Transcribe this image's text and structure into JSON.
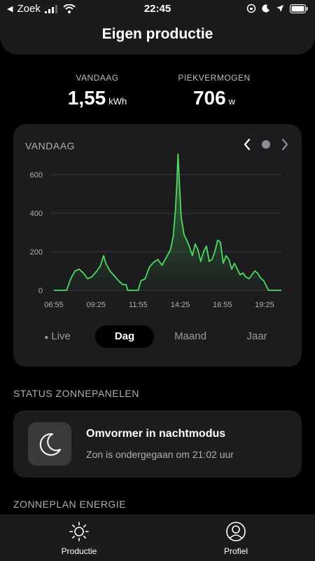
{
  "statusbar": {
    "back_label": "Zoek",
    "time": "22:45"
  },
  "header": {
    "title": "Eigen productie"
  },
  "stats": [
    {
      "label": "VANDAAG",
      "value": "1,55",
      "unit": "kWh"
    },
    {
      "label": "PIEKVERMOGEN",
      "value": "706",
      "unit": "w"
    }
  ],
  "chart_card": {
    "title": "VANDAAG",
    "tabs": [
      {
        "label": "Live",
        "active": false
      },
      {
        "label": "Dag",
        "active": true
      },
      {
        "label": "Maand",
        "active": false
      },
      {
        "label": "Jaar",
        "active": false
      }
    ]
  },
  "chart_data": {
    "type": "area",
    "title": "",
    "xlabel": "",
    "ylabel": "",
    "ylim": [
      0,
      600
    ],
    "yticks": [
      0,
      200,
      400,
      600
    ],
    "x_tick_labels": [
      "06:55",
      "09:25",
      "11:55",
      "14:25",
      "16:55",
      "19:25"
    ],
    "x_tick_minutes": [
      415,
      565,
      715,
      865,
      1015,
      1165
    ],
    "xlim_minutes": [
      415,
      1225
    ],
    "line_color": "#4cd964",
    "grid": true,
    "series": [
      {
        "values": [
          [
            415,
            0
          ],
          [
            460,
            0
          ],
          [
            475,
            60
          ],
          [
            490,
            100
          ],
          [
            505,
            110
          ],
          [
            520,
            90
          ],
          [
            535,
            60
          ],
          [
            550,
            70
          ],
          [
            565,
            95
          ],
          [
            580,
            125
          ],
          [
            592,
            180
          ],
          [
            600,
            140
          ],
          [
            615,
            100
          ],
          [
            630,
            75
          ],
          [
            645,
            50
          ],
          [
            660,
            30
          ],
          [
            672,
            30
          ],
          [
            678,
            0
          ],
          [
            715,
            0
          ],
          [
            725,
            50
          ],
          [
            740,
            60
          ],
          [
            755,
            120
          ],
          [
            770,
            145
          ],
          [
            785,
            160
          ],
          [
            800,
            130
          ],
          [
            815,
            170
          ],
          [
            830,
            210
          ],
          [
            840,
            280
          ],
          [
            848,
            420
          ],
          [
            853,
            560
          ],
          [
            857,
            706
          ],
          [
            861,
            580
          ],
          [
            868,
            380
          ],
          [
            878,
            290
          ],
          [
            888,
            260
          ],
          [
            898,
            225
          ],
          [
            908,
            180
          ],
          [
            918,
            240
          ],
          [
            928,
            210
          ],
          [
            938,
            150
          ],
          [
            948,
            200
          ],
          [
            958,
            230
          ],
          [
            968,
            150
          ],
          [
            978,
            160
          ],
          [
            988,
            200
          ],
          [
            998,
            260
          ],
          [
            1008,
            250
          ],
          [
            1018,
            140
          ],
          [
            1028,
            180
          ],
          [
            1038,
            160
          ],
          [
            1048,
            110
          ],
          [
            1058,
            140
          ],
          [
            1068,
            110
          ],
          [
            1078,
            80
          ],
          [
            1088,
            90
          ],
          [
            1098,
            70
          ],
          [
            1110,
            60
          ],
          [
            1120,
            80
          ],
          [
            1130,
            100
          ],
          [
            1140,
            90
          ],
          [
            1150,
            65
          ],
          [
            1162,
            50
          ],
          [
            1172,
            20
          ],
          [
            1180,
            0
          ],
          [
            1225,
            0
          ]
        ]
      }
    ]
  },
  "status_section": {
    "title": "STATUS ZONNEPANELEN",
    "card_title": "Omvormer in nachtmodus",
    "card_subtitle": "Zon is ondergegaan om 21:02 uur"
  },
  "energy_section": {
    "title": "ZONNEPLAN ENERGIE"
  },
  "bottom_nav": [
    {
      "label": "Productie",
      "icon": "sun-icon"
    },
    {
      "label": "Profiel",
      "icon": "profile-icon"
    }
  ]
}
